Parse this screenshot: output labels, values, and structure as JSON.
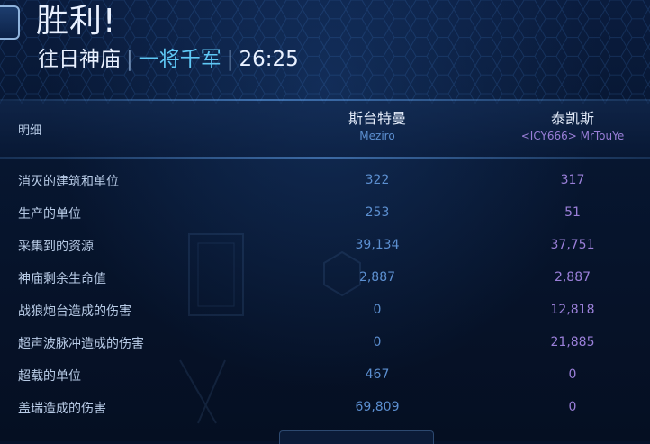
{
  "header": {
    "title": "胜利!",
    "map": "往日神庙",
    "separator": "|",
    "mode": "一将千军",
    "duration": "26:25"
  },
  "table": {
    "details_label": "明细",
    "players": [
      {
        "name": "斯台特曼",
        "id": "Meziro",
        "color": "#5c8fd0"
      },
      {
        "name": "泰凯斯",
        "id": "<ICY666> MrTouYe",
        "color": "#9a7fd8"
      }
    ],
    "rows": [
      {
        "label": "消灭的建筑和单位",
        "p1": "322",
        "p2": "317"
      },
      {
        "label": "生产的单位",
        "p1": "253",
        "p2": "51"
      },
      {
        "label": "采集到的资源",
        "p1": "39,134",
        "p2": "37,751"
      },
      {
        "label": "神庙剩余生命值",
        "p1": "2,887",
        "p2": "2,887"
      },
      {
        "label": "战狼炮台造成的伤害",
        "p1": "0",
        "p2": "12,818"
      },
      {
        "label": "超声波脉冲造成的伤害",
        "p1": "0",
        "p2": "21,885"
      },
      {
        "label": "超载的单位",
        "p1": "467",
        "p2": "0"
      },
      {
        "label": "盖瑞造成的伤害",
        "p1": "69,809",
        "p2": "0"
      }
    ]
  },
  "colors": {
    "accent": "#5fc8f5",
    "background": "#06122a"
  }
}
